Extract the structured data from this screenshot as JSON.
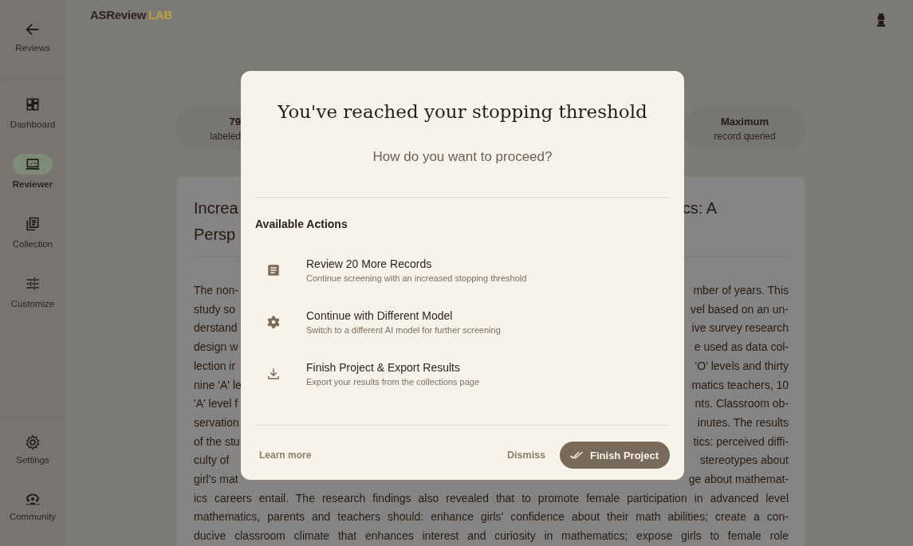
{
  "nav": {
    "back": {
      "label": "Reviews"
    },
    "items": [
      {
        "label": "Dashboard",
        "selected": false
      },
      {
        "label": "Reviewer",
        "selected": true
      },
      {
        "label": "Collection",
        "selected": false
      },
      {
        "label": "Customize",
        "selected": false
      }
    ],
    "bottom": [
      {
        "label": "Settings"
      },
      {
        "label": "Community"
      }
    ]
  },
  "header": {
    "logo": "ASReview",
    "logo_accent": "LAB"
  },
  "stats": [
    {
      "value": "79",
      "label": "labeled"
    },
    {
      "value": "Maximum",
      "label": "record queried"
    }
  ],
  "record": {
    "title_left": [
      "Increa",
      "Persp"
    ],
    "title_right": "cs: A",
    "abstract_rows": [
      {
        "left": "The non-",
        "right": "mber of years. This"
      },
      {
        "left": "study so",
        "right": "vel based on an un-"
      },
      {
        "left": "derstand",
        "right": "ive survey research"
      },
      {
        "left": "design w",
        "right": "e used as data col-"
      },
      {
        "left": "lection ir",
        "right": "'O' levels and thirty"
      },
      {
        "left": "nine 'A' le",
        "right": "matics teachers, 10"
      },
      {
        "left": "'A' level f",
        "right": "nts. Classroom ob-"
      },
      {
        "left": "servation",
        "right": "inutes. The results"
      },
      {
        "left": "of the stu",
        "right": "tics: perceived diffi-"
      },
      {
        "left": "culty of",
        "right": "stereotypes about"
      },
      {
        "left": "girl's mat",
        "right": "ge about mathemat-"
      }
    ],
    "abstract_lines": [
      "ics careers entail. The research findings also revealed that to promote female participation in advanced level",
      "mathematics, parents and teachers should: enhance girls' confidence about their math abilities; create a con-",
      "ducive classroom climate that enhances interest and curiosity in mathematics; expose girls to female role"
    ]
  },
  "dialog": {
    "title": "You've reached your stopping threshold",
    "subtitle": "How do you want to proceed?",
    "section": "Available Actions",
    "actions": [
      {
        "title": "Review 20 More Records",
        "description": "Continue screening with an increased stopping threshold"
      },
      {
        "title": "Continue with Different Model",
        "description": "Switch to a different AI model for further screening"
      },
      {
        "title": "Finish Project & Export Results",
        "description": "Export your results from the collections page"
      }
    ],
    "learn_more": "Learn more",
    "dismiss": "Dismiss",
    "primary": "Finish Project"
  }
}
